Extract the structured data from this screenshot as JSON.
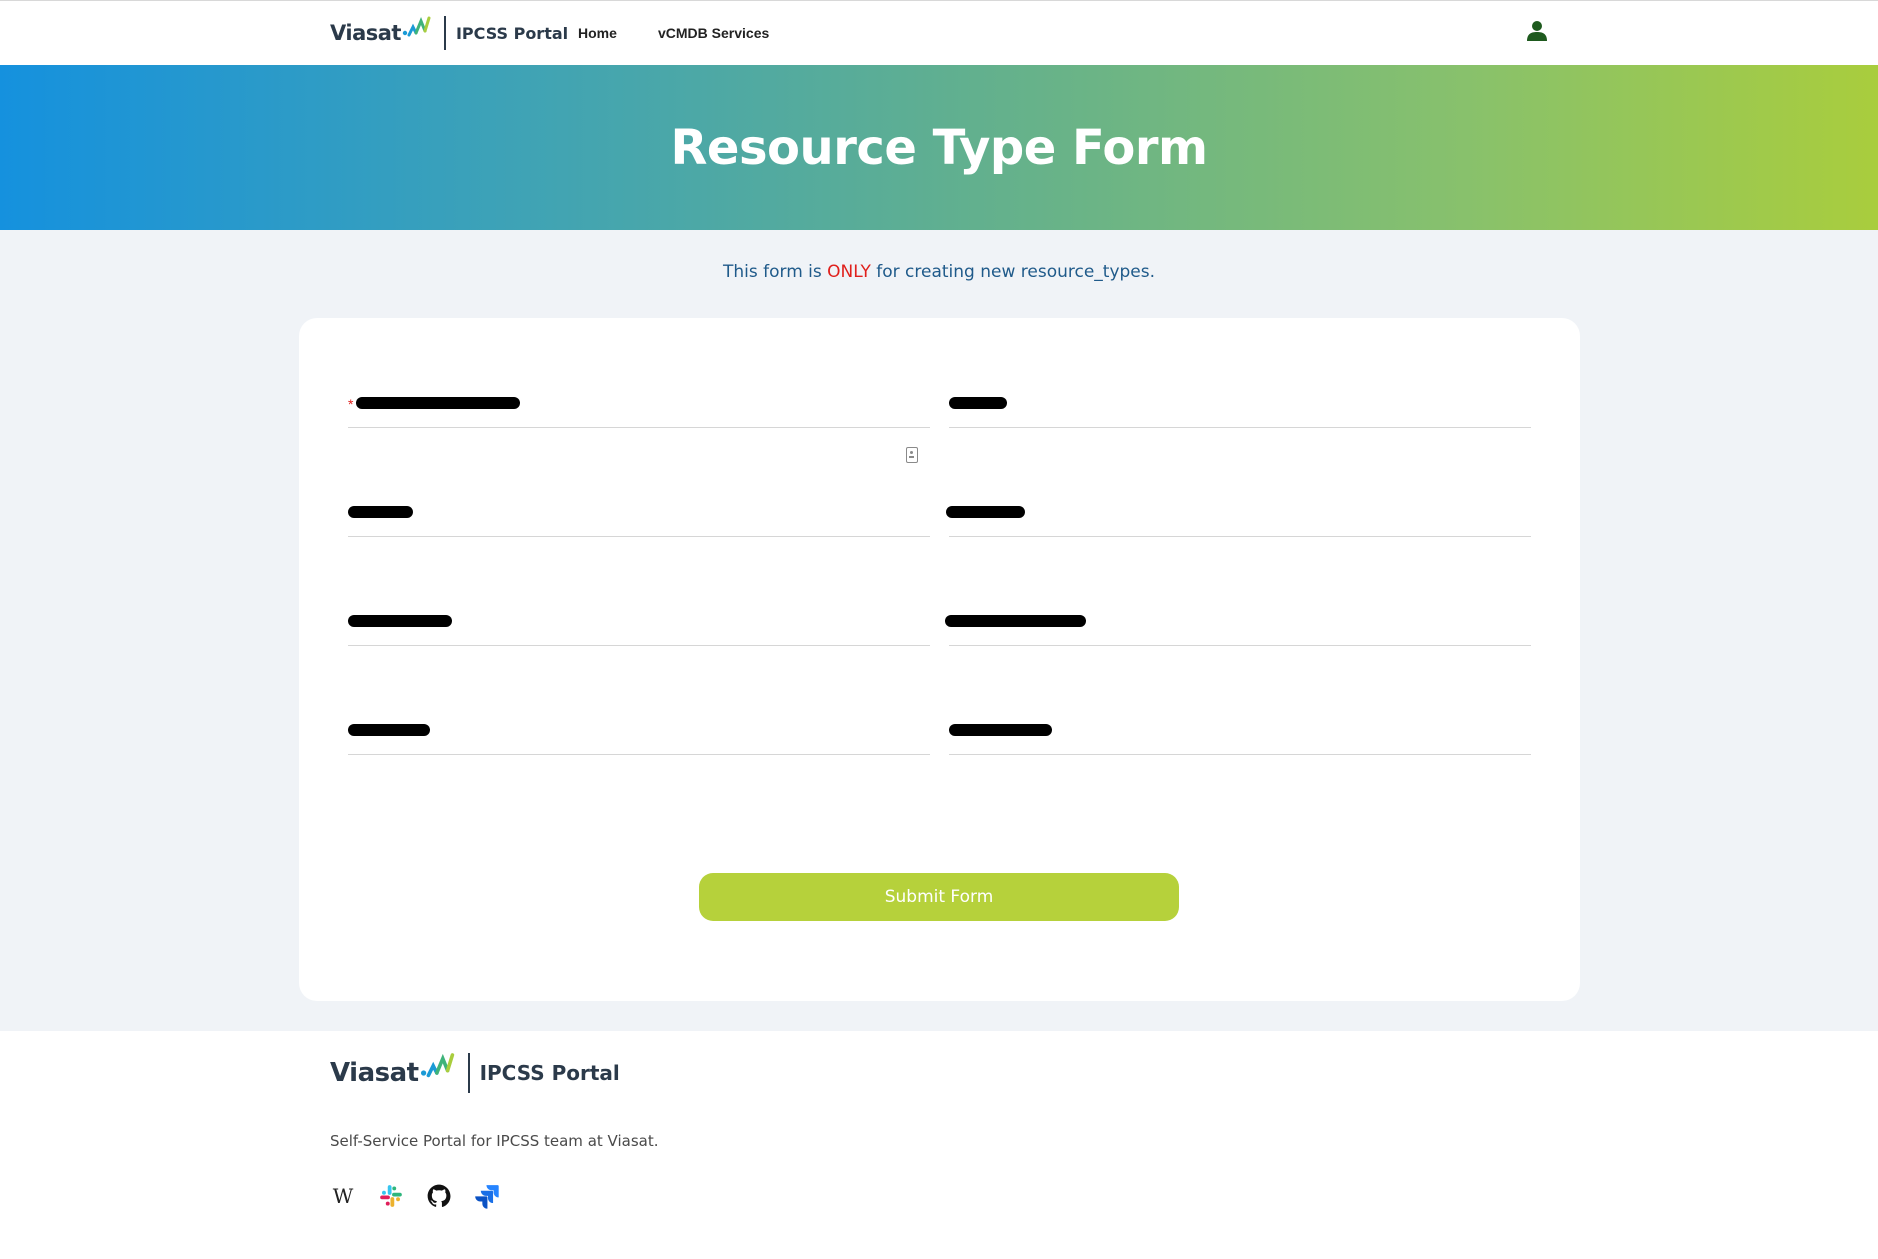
{
  "nav": {
    "logo_text": "Viasat",
    "brand_name": "IPCSS Portal",
    "links": [
      {
        "label": "Home"
      },
      {
        "label": "vCMDB Services"
      }
    ],
    "user_icon": "user-icon"
  },
  "hero": {
    "title": "Resource Type Form"
  },
  "notice": {
    "prefix": "This form is ",
    "emphasis": "ONLY",
    "suffix": " for creating new resource_types."
  },
  "form": {
    "fields": [
      {
        "required": true,
        "redacted": true
      },
      {
        "required": false,
        "redacted": true
      },
      {
        "required": false,
        "redacted": true
      },
      {
        "required": false,
        "redacted": true
      },
      {
        "required": false,
        "redacted": true
      },
      {
        "required": false,
        "redacted": true
      },
      {
        "required": false,
        "redacted": true
      },
      {
        "required": false,
        "redacted": true
      }
    ],
    "required_marker": "*",
    "submit_label": "Submit Form"
  },
  "footer": {
    "logo_text": "Viasat",
    "brand_name": "IPCSS Portal",
    "description": "Self-Service Portal for IPCSS team at Viasat.",
    "icons": [
      "wikipedia-icon",
      "slack-icon",
      "github-icon",
      "jira-icon"
    ],
    "wiki_glyph": "W"
  },
  "colors": {
    "accent_green": "#b6d13b",
    "gradient_start": "#1591de",
    "gradient_end": "#a9cd3d",
    "notice_blue": "#1f5a8a",
    "emphasis_red": "#e0201c"
  }
}
